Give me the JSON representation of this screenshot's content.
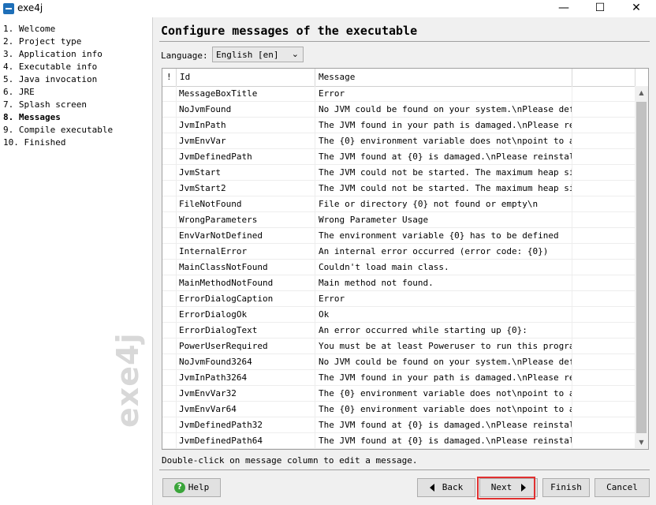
{
  "window": {
    "title": "exe4j",
    "minimize": "—",
    "maximize": "☐",
    "close": "✕"
  },
  "sidebar": {
    "steps": [
      {
        "label": "1.  Welcome",
        "active": false
      },
      {
        "label": "2.  Project type",
        "active": false
      },
      {
        "label": "3.  Application info",
        "active": false
      },
      {
        "label": "4.  Executable info",
        "active": false
      },
      {
        "label": "5.  Java invocation",
        "active": false
      },
      {
        "label": "6.  JRE",
        "active": false
      },
      {
        "label": "7.  Splash screen",
        "active": false
      },
      {
        "label": "8.  Messages",
        "active": true
      },
      {
        "label": "9.  Compile executable",
        "active": false
      },
      {
        "label": "10.  Finished",
        "active": false
      }
    ],
    "watermark": "exe4j"
  },
  "main": {
    "title": "Configure messages of the executable",
    "language_label": "Language:",
    "language_value": "English [en]",
    "table": {
      "headers": {
        "flag": "!",
        "id": "Id",
        "message": "Message"
      },
      "rows": [
        {
          "id": "MessageBoxTitle",
          "message": "Error"
        },
        {
          "id": "NoJvmFound",
          "message": "No JVM could be found on your system.\\nPlease defi..."
        },
        {
          "id": "JvmInPath",
          "message": "The JVM found in your path is damaged.\\nPlease rei..."
        },
        {
          "id": "JvmEnvVar",
          "message": "The {0} environment variable does not\\npoint to a ..."
        },
        {
          "id": "JvmDefinedPath",
          "message": "The JVM found at {0} is damaged.\\nPlease reinstall..."
        },
        {
          "id": "JvmStart",
          "message": "The JVM could not be started. The maximum heap siz..."
        },
        {
          "id": "JvmStart2",
          "message": "The JVM could not be started. The maximum heap siz..."
        },
        {
          "id": "FileNotFound",
          "message": "File or directory {0} not found or empty\\n"
        },
        {
          "id": "WrongParameters",
          "message": "Wrong Parameter Usage"
        },
        {
          "id": "EnvVarNotDefined",
          "message": "The environment variable {0} has to be defined"
        },
        {
          "id": "InternalError",
          "message": "An internal error occurred (error code: {0})"
        },
        {
          "id": "MainClassNotFound",
          "message": "Couldn't load main class."
        },
        {
          "id": "MainMethodNotFound",
          "message": "Main method not found."
        },
        {
          "id": "ErrorDialogCaption",
          "message": "Error"
        },
        {
          "id": "ErrorDialogOk",
          "message": "Ok"
        },
        {
          "id": "ErrorDialogText",
          "message": "An error occurred while starting up {0}:"
        },
        {
          "id": "PowerUserRequired",
          "message": "You must be at least Poweruser to run this program."
        },
        {
          "id": "NoJvmFound3264",
          "message": "No JVM could be found on your system.\\nPlease defi..."
        },
        {
          "id": "JvmInPath3264",
          "message": "The JVM found in your path is damaged.\\nPlease rei..."
        },
        {
          "id": "JvmEnvVar32",
          "message": "The {0} environment variable does not\\npoint to a ..."
        },
        {
          "id": "JvmEnvVar64",
          "message": "The {0} environment variable does not\\npoint to a ..."
        },
        {
          "id": "JvmDefinedPath32",
          "message": "The JVM found at {0} is damaged.\\nPlease reinstall..."
        },
        {
          "id": "JvmDefinedPath64",
          "message": "The JVM found at {0} is damaged.\\nPlease reinstall..."
        }
      ]
    },
    "hint": "Double-click on message column to edit a message."
  },
  "footer": {
    "help": "Help",
    "back": "Back",
    "next": "Next",
    "finish": "Finish",
    "cancel": "Cancel"
  },
  "colors": {
    "highlight": "#e03030",
    "help_icon": "#3aa53a"
  }
}
